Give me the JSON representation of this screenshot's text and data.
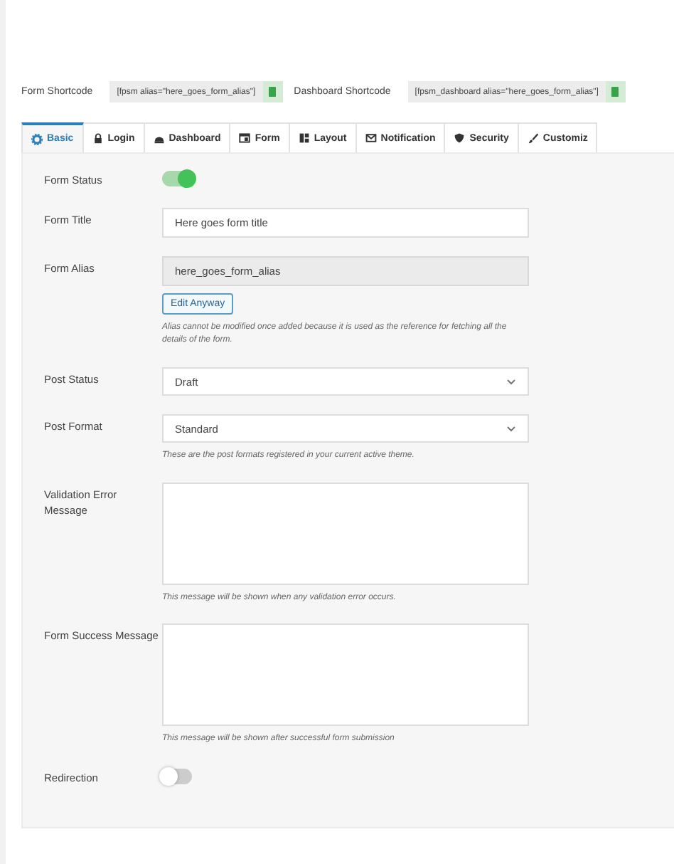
{
  "shortcodes": [
    {
      "label": "Form Shortcode",
      "code": "[fpsm alias=\"here_goes_form_alias\"]"
    },
    {
      "label": "Dashboard Shortcode",
      "code": "[fpsm_dashboard alias=\"here_goes_form_alias\"]"
    }
  ],
  "tabs": [
    {
      "label": "Basic",
      "selected": true
    },
    {
      "label": "Login",
      "selected": false
    },
    {
      "label": "Dashboard",
      "selected": false
    },
    {
      "label": "Form",
      "selected": false
    },
    {
      "label": "Layout",
      "selected": false
    },
    {
      "label": "Notification",
      "selected": false
    },
    {
      "label": "Security",
      "selected": false
    },
    {
      "label": "Customiz",
      "selected": false
    }
  ],
  "fields": [
    {
      "kind": "toggle",
      "label": "Form Status",
      "on": true
    },
    {
      "kind": "text",
      "label": "Form Title",
      "value": "Here goes form title"
    },
    {
      "kind": "readonly",
      "label": "Form Alias",
      "value": "here_goes_form_alias",
      "button": "Edit Anyway",
      "hint": "Alias cannot be modified once added because it is used as the reference for fetching all the details of the form."
    },
    {
      "kind": "select",
      "label": "Post Status",
      "value": "Draft"
    },
    {
      "kind": "select",
      "label": "Post Format",
      "value": "Standard",
      "hint": "These are the post formats registered in your current active theme."
    },
    {
      "kind": "textarea",
      "label": "Validation Error Message",
      "hint": "This message will be shown when any validation error occurs."
    },
    {
      "kind": "textarea",
      "label": "Form Success Message",
      "hint": "This message will be shown after successful form submission"
    },
    {
      "kind": "toggle",
      "label": "Redirection",
      "on": false
    }
  ]
}
